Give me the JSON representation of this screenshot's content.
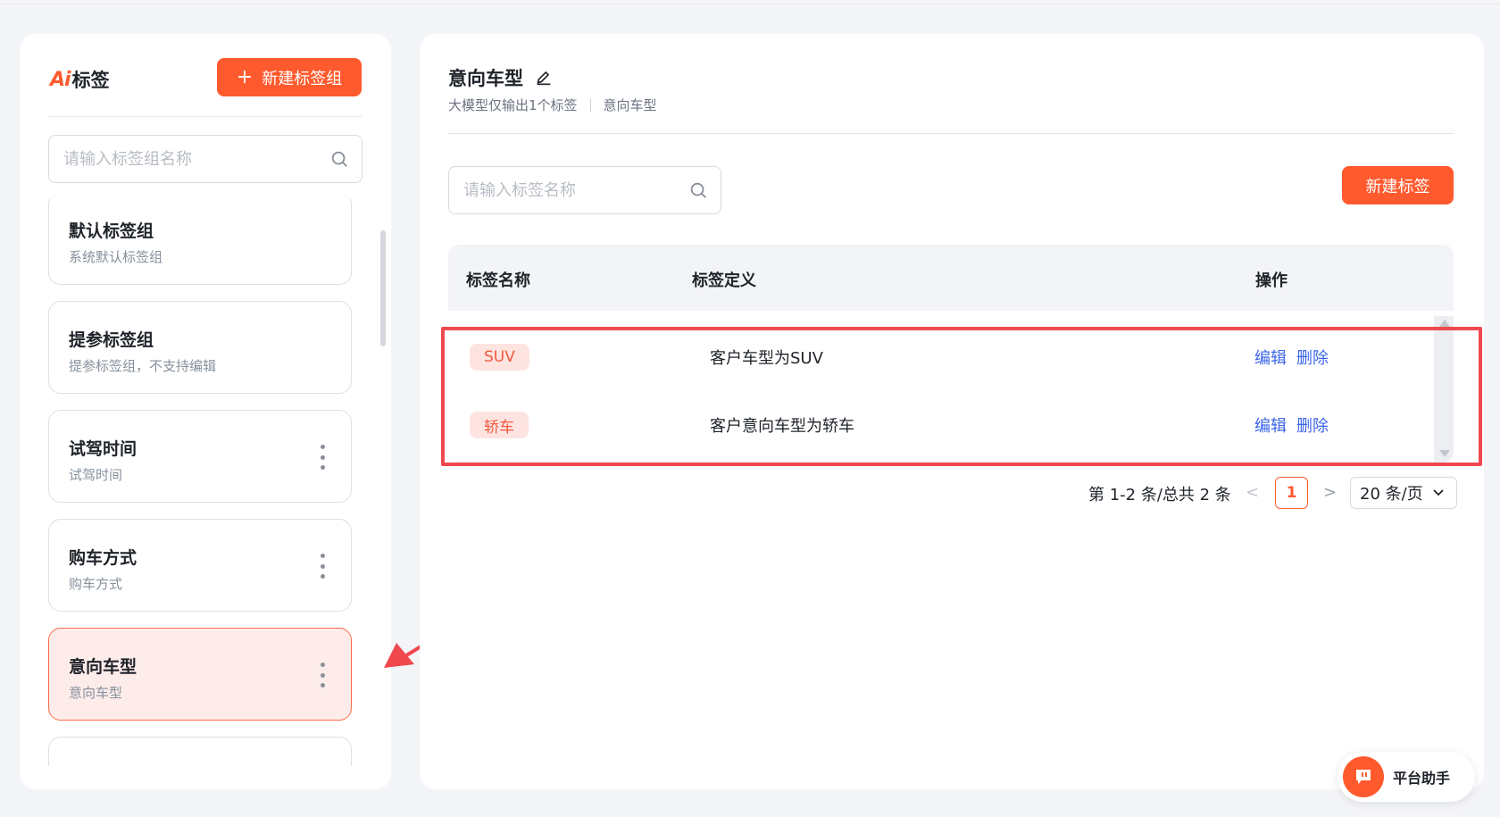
{
  "left": {
    "brand_logo": "Ai",
    "brand_title": "标签",
    "new_group_label": "新建标签组",
    "search_placeholder": "请输入标签组名称",
    "groups": [
      {
        "name": "默认标签组",
        "desc": "系统默认标签组",
        "has_menu": false,
        "active": false
      },
      {
        "name": "提参标签组",
        "desc": "提参标签组，不支持编辑",
        "has_menu": false,
        "active": false
      },
      {
        "name": "试驾时间",
        "desc": "试驾时间",
        "has_menu": true,
        "active": false
      },
      {
        "name": "购车方式",
        "desc": "购车方式",
        "has_menu": true,
        "active": false
      },
      {
        "name": "意向车型",
        "desc": "意向车型",
        "has_menu": true,
        "active": true
      }
    ]
  },
  "main": {
    "title": "意向车型",
    "subtitle_mode": "大模型仅输出1个标签",
    "subtitle_name": "意向车型",
    "search_placeholder": "请输入标签名称",
    "new_tag_label": "新建标签",
    "columns": [
      "标签名称",
      "标签定义",
      "操作"
    ],
    "rows": [
      {
        "tag": "SUV",
        "definition": "客户车型为SUV",
        "edit": "编辑",
        "delete": "删除"
      },
      {
        "tag": "轿车",
        "definition": "客户意向车型为轿车",
        "edit": "编辑",
        "delete": "删除"
      }
    ],
    "pagination": {
      "total_text": "第 1-2 条/总共 2 条",
      "prev": "<",
      "current_page": "1",
      "next": ">",
      "page_size": "20 条/页"
    }
  },
  "assistant": {
    "label": "平台助手"
  },
  "colors": {
    "accent": "#ff5a2e",
    "link": "#3b64e8",
    "highlight": "#f0484f",
    "active_bg": "#fdecea"
  }
}
